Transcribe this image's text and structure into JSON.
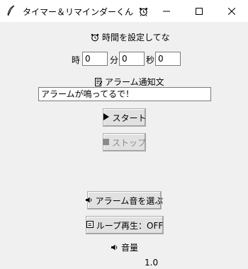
{
  "window": {
    "title": "タイマー＆リマインダーくん",
    "title_icon": "alarm-clock-icon",
    "app_icon": "feather-icon",
    "minimize_glyph": "—",
    "close_glyph": "✕"
  },
  "time_section": {
    "heading": "時間を設定してな",
    "heading_icon": "alarm-clock-icon",
    "hours_label": "時",
    "hours_value": "0",
    "minutes_label": "分",
    "minutes_value": "0",
    "seconds_label": "秒",
    "seconds_value": "0"
  },
  "alarm_text": {
    "label": "アラーム通知文",
    "label_icon": "memo-icon",
    "value": "アラームが鳴ってるで！"
  },
  "buttons": {
    "start": {
      "label": "スタート",
      "icon": "play-icon",
      "enabled": true
    },
    "stop": {
      "label": "ストップ",
      "icon": "stop-icon",
      "enabled": false
    },
    "choose_sound": {
      "label": "アラーム音を選ぶ",
      "icon": "speaker-icon"
    },
    "loop": {
      "label": "ループ再生：OFF",
      "icon": "repeat-icon"
    }
  },
  "volume": {
    "label": "音量",
    "icon": "speaker-icon",
    "value": "1.0"
  },
  "colors": {
    "background": "#f0f0f0",
    "titlebar": "#ffffff",
    "button_face": "#e1e1e1"
  }
}
